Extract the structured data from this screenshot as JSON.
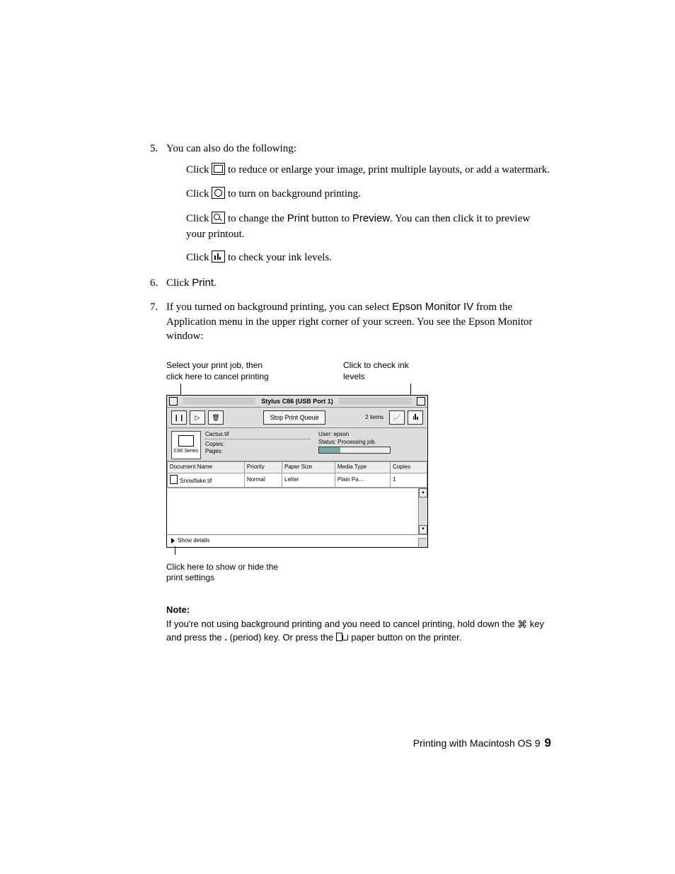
{
  "steps": {
    "s5": {
      "intro": "You can also do the following:",
      "a_pre": "Click ",
      "a_post": " to reduce or enlarge your image, print multiple layouts, or add a watermark.",
      "b_pre": "Click ",
      "b_post": " to turn on background printing.",
      "c_pre": "Click ",
      "c_mid1": " to change the ",
      "c_print": "Print",
      "c_mid2": " button to ",
      "c_preview": "Preview",
      "c_post": ". You can then click it to preview your printout.",
      "d_pre": "Click ",
      "d_post": " to check your ink levels."
    },
    "s6_pre": "Click ",
    "s6_print": "Print",
    "s6_post": ".",
    "s7_pre": "If you turned on background printing, you can select ",
    "s7_app": "Epson Monitor IV",
    "s7_post": " from the Application menu in the upper right corner of your screen. You see the Epson Monitor window:"
  },
  "annotations": {
    "top_left": "Select your print job, then click here to cancel printing",
    "top_right": "Click to check ink levels",
    "bottom": "Click here to show or hide the print settings"
  },
  "window": {
    "title": "Stylus C86 (USB Port 1)",
    "stop_queue": "Stop Print Queue",
    "items": "2 items",
    "printer_label": "C86 Series",
    "file": "Cactus.tif",
    "copies_label": "Copies:",
    "pages_label": "Pages:",
    "user_label": "User:",
    "user_value": "epson",
    "status_label": "Status:",
    "status_value": "Processing job.",
    "headers": [
      "Document Name",
      "Priority",
      "Paper Size",
      "Media Type",
      "Copies"
    ],
    "row": [
      "Snowflake.tif",
      "Normal",
      "Letter",
      "Plain Pa…",
      "1"
    ],
    "show_details": "Show details"
  },
  "note": {
    "heading": "Note:",
    "t1": "If you're not using background printing and you need to cancel printing, hold down the ",
    "t2": " key and press the ",
    "period": ".",
    "t3": " (period) key. Or press the ",
    "t4": " paper button on the printer."
  },
  "footer": {
    "text": "Printing with Macintosh OS 9",
    "page": "9"
  }
}
